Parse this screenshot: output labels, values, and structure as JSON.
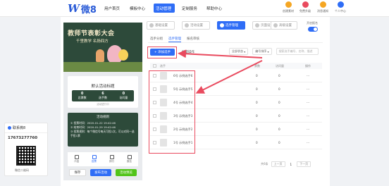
{
  "brand": {
    "logo_letter": "W",
    "logo_text": "微8"
  },
  "nav": [
    {
      "label": "用户首页"
    },
    {
      "label": "模板中心"
    },
    {
      "label": "活动管理"
    },
    {
      "label": "定制服务"
    },
    {
      "label": "帮助中心"
    }
  ],
  "nav_active_index": 2,
  "right_icons": [
    {
      "label": "创建素材",
      "color": "#f5a623"
    },
    {
      "label": "免费升级",
      "color": "#e94a5e"
    },
    {
      "label": "消息通知",
      "color": "#f5a623"
    },
    {
      "label": "个人中心",
      "color": "#2f6df6"
    }
  ],
  "contact": {
    "title": "联系微8",
    "phone": "17673277760",
    "qr_label": "微信二维码"
  },
  "steps": [
    {
      "label": "基础设置",
      "active": false
    },
    {
      "label": "活动设置",
      "active": false
    },
    {
      "label": "选手管理",
      "active": true
    },
    {
      "label": "页面设置",
      "active": false
    },
    {
      "label": "高级设置",
      "active": false
    }
  ],
  "toggle_label": "开启报名",
  "preview": {
    "banner_title": "教师节表彰大会",
    "banner_sub": "千里教学  名扬四方",
    "stats_title": "默认活动标题",
    "stats": [
      {
        "value": "0",
        "label": "总票数"
      },
      {
        "value": "6",
        "label": "选手数"
      },
      {
        "value": "0",
        "label": "访问量"
      }
    ],
    "stats_foot": "活动进行中",
    "rules_title": "活动规则",
    "rules": [
      "① 投票时间：2020-01-22 19:42:46",
      "② 结束时间：2020-01-29 19:42:46",
      "③ 投票规则：每个微信号每天可投1次，可以对同一选手投1票"
    ],
    "tabs": [
      {
        "label": "介绍",
        "active": false
      },
      {
        "label": "投票",
        "active": true
      },
      {
        "label": "排行",
        "active": false
      },
      {
        "label": "报名",
        "active": false
      }
    ]
  },
  "bottom_buttons": {
    "save": "保存",
    "publish": "发布活动",
    "preview": "活动预览"
  },
  "subtabs": [
    {
      "label": "选手分组",
      "on": false
    },
    {
      "label": "选手管理",
      "on": true
    },
    {
      "label": "报名审核",
      "on": false
    }
  ],
  "add_button": "+ 添加选手",
  "batch_label": "批量操作",
  "filters": {
    "select1": "全部状态",
    "select2": "编号排序",
    "search_placeholder": "搜索选手编号、名称、描述"
  },
  "table": {
    "headers": {
      "player": "选手",
      "votes": "票数",
      "visits": "访问量",
      "ops": "操作"
    },
    "rows": [
      {
        "num": "6号",
        "name": "示例选手6",
        "votes": "0",
        "visits": "0",
        "ops": "···"
      },
      {
        "num": "5号",
        "name": "示例选手5",
        "votes": "0",
        "visits": "0",
        "ops": "···"
      },
      {
        "num": "4号",
        "name": "示例选手4",
        "votes": "0",
        "visits": "0",
        "ops": "···"
      },
      {
        "num": "3号",
        "name": "示例选手3",
        "votes": "0",
        "visits": "0",
        "ops": "···"
      },
      {
        "num": "2号",
        "name": "示例选手2",
        "votes": "0",
        "visits": "0",
        "ops": "···"
      },
      {
        "num": "1号",
        "name": "示例选手1",
        "votes": "0",
        "visits": "0",
        "ops": "···"
      }
    ]
  },
  "pager": {
    "total": "共6条",
    "prev": "上一页",
    "page": "1",
    "next": "下一页"
  },
  "colors": {
    "accent": "#2f6df6",
    "highlight": "#e94a5e",
    "chalkboard": "#2d4a3a"
  }
}
